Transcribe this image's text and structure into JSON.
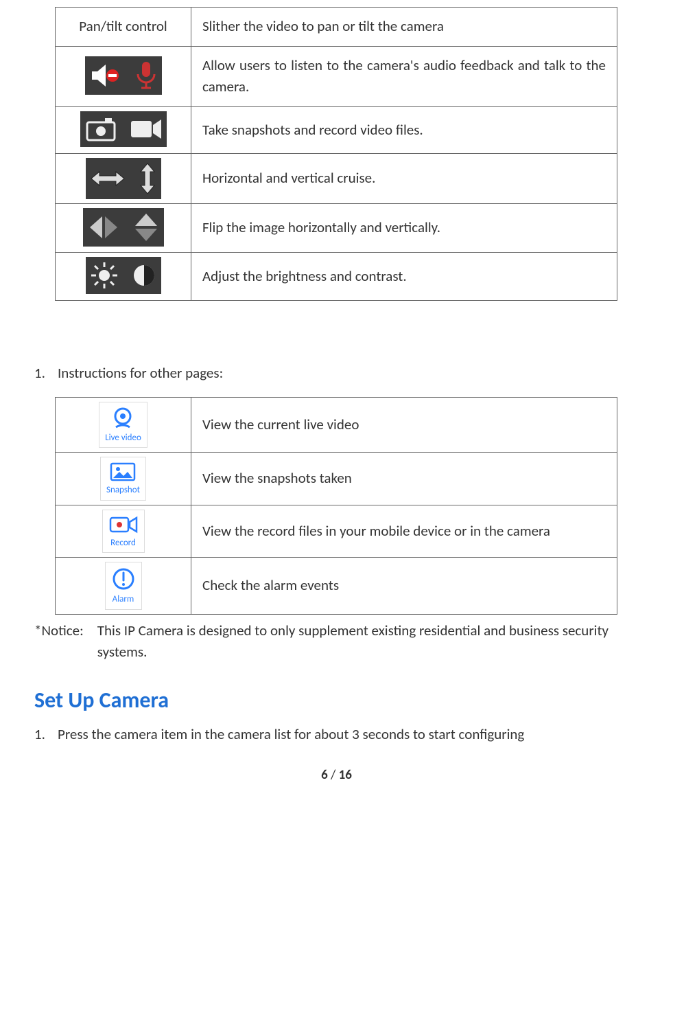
{
  "table1": {
    "rows": [
      {
        "label": "Pan/tilt control",
        "desc": "Slither the video to pan or tilt the camera"
      },
      {
        "desc": "Allow users to listen to the camera's audio feedback and talk to the camera."
      },
      {
        "desc": "Take snapshots and record video files."
      },
      {
        "desc": "Horizontal and vertical cruise."
      },
      {
        "desc": "Flip the image horizontally and vertically."
      },
      {
        "desc": "Adjust the brightness and contrast."
      }
    ]
  },
  "instructions_heading_num": "1.",
  "instructions_heading": "Instructions for other pages:",
  "table2": {
    "rows": [
      {
        "label": "Live video",
        "desc": "View the current live video"
      },
      {
        "label": "Snapshot",
        "desc": "View the snapshots taken"
      },
      {
        "label": "Record",
        "desc": "View the record files in your mobile device or in the camera"
      },
      {
        "label": "Alarm",
        "desc": "Check the alarm events"
      }
    ]
  },
  "notice_label": "*Notice:",
  "notice_text": "This IP Camera is designed to only supplement existing residential and business security systems.",
  "setup_heading": "Set Up Camera",
  "setup_item_num": "1.",
  "setup_item_text": "Press the camera item in the camera list for about 3 seconds to start configuring",
  "footer_page": "6",
  "footer_sep": " / ",
  "footer_total": "16"
}
